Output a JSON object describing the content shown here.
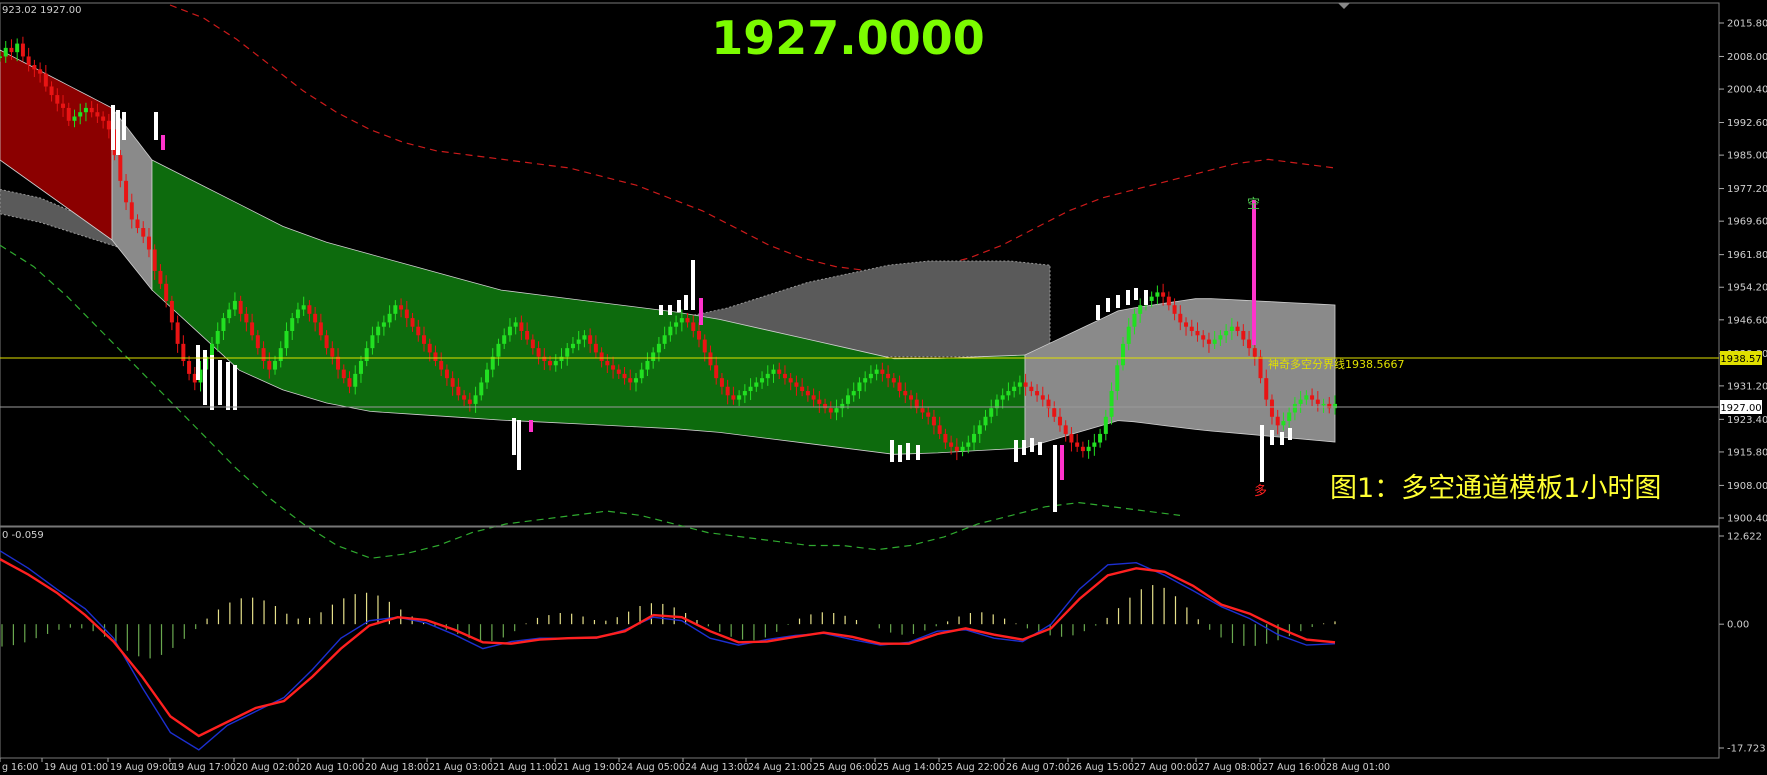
{
  "chart_data": [
    {
      "type": "candlestick",
      "header": "923.02 1927.00",
      "big_price": "1927.0000",
      "big_price_color": "#7cfc00",
      "price_ticks": [
        "2015.80",
        "2008.00",
        "2000.40",
        "1992.60",
        "1985.00",
        "1977.20",
        "1969.60",
        "1961.80",
        "1954.20",
        "1946.60",
        "1938.80",
        "1931.20",
        "1923.40",
        "1915.80",
        "1908.00",
        "1900.40"
      ],
      "price_tick_values": [
        2015.8,
        2008.0,
        2000.4,
        1992.6,
        1985.0,
        1977.2,
        1969.6,
        1961.8,
        1954.2,
        1946.6,
        1938.8,
        1931.2,
        1923.4,
        1915.8,
        1908.0,
        1900.4
      ],
      "ylim": [
        1900.4,
        2015.8
      ],
      "boundary_label": "1938.57",
      "boundary_value": 1938.57,
      "current_label": "1927.00",
      "current_value": 1927.0,
      "boundary_text": "神奇多空分界线1938.5667",
      "signal_sell_text": "空",
      "signal_buy_text": "多",
      "caption": "图1：多空通道模板1小时图",
      "time_labels": [
        "g 16:00",
        "19 Aug 01:00",
        "19 Aug 09:00",
        "19 Aug 17:00",
        "20 Aug 02:00",
        "20 Aug 10:00",
        "20 Aug 18:00",
        "21 Aug 03:00",
        "21 Aug 11:00",
        "21 Aug 19:00",
        "24 Aug 05:00",
        "24 Aug 13:00",
        "24 Aug 21:00",
        "25 Aug 06:00",
        "25 Aug 14:00",
        "25 Aug 22:00",
        "26 Aug 07:00",
        "26 Aug 15:00",
        "27 Aug 00:00",
        "27 Aug 08:00",
        "27 Aug 16:00",
        "28 Aug 01:00"
      ],
      "closes": [
        2008,
        2010,
        2009,
        2011,
        2008,
        2006,
        2005,
        2004,
        2001,
        1999,
        1997,
        1996,
        1993,
        1994,
        1995,
        1996,
        1995,
        1994,
        1993,
        1991,
        1985,
        1979,
        1974,
        1970,
        1968,
        1966,
        1963,
        1958,
        1955,
        1951,
        1946,
        1941,
        1937,
        1934,
        1932,
        1935,
        1938,
        1941,
        1944,
        1947,
        1949,
        1951,
        1948,
        1946,
        1943,
        1940,
        1937,
        1935,
        1937,
        1940,
        1944,
        1947,
        1949,
        1950,
        1948,
        1946,
        1943,
        1940,
        1938,
        1935,
        1933,
        1931,
        1934,
        1937,
        1940,
        1943,
        1945,
        1946,
        1948,
        1950,
        1949,
        1947,
        1945,
        1943,
        1941,
        1939,
        1937,
        1935,
        1933,
        1931,
        1929,
        1928,
        1927,
        1929,
        1932,
        1935,
        1938,
        1941,
        1943,
        1945,
        1946,
        1944,
        1942,
        1940,
        1938,
        1937,
        1936,
        1937,
        1938,
        1940,
        1941,
        1942,
        1943,
        1941,
        1939,
        1937,
        1936,
        1935,
        1934,
        1933,
        1932,
        1933,
        1935,
        1937,
        1939,
        1941,
        1943,
        1945,
        1946,
        1947,
        1946,
        1944,
        1942,
        1939,
        1936,
        1933,
        1931,
        1929,
        1928,
        1929,
        1930,
        1931,
        1932,
        1933,
        1934,
        1935,
        1934,
        1933,
        1932,
        1931,
        1930,
        1929,
        1928,
        1927,
        1926,
        1925,
        1926,
        1927,
        1929,
        1930,
        1932,
        1933,
        1934,
        1935,
        1934,
        1933,
        1932,
        1930,
        1929,
        1928,
        1926,
        1925,
        1924,
        1922,
        1920,
        1918,
        1917,
        1916,
        1917,
        1918,
        1920,
        1922,
        1924,
        1926,
        1928,
        1929,
        1930,
        1931,
        1932,
        1931,
        1930,
        1929,
        1928,
        1926,
        1924,
        1922,
        1920,
        1918,
        1917,
        1916,
        1917,
        1918,
        1920,
        1924,
        1930,
        1936,
        1941,
        1945,
        1948,
        1950,
        1951,
        1952,
        1953,
        1952,
        1950,
        1948,
        1946,
        1945,
        1944,
        1943,
        1942,
        1941,
        1942,
        1943,
        1944,
        1945,
        1944,
        1942,
        1940,
        1938,
        1933,
        1928,
        1924,
        1922,
        1923,
        1925,
        1927,
        1928,
        1929,
        1928,
        1927,
        1927,
        1926,
        1927
      ],
      "upper_red_line": [
        2020,
        2017,
        2012,
        2006,
        2000,
        1995,
        1991,
        1988,
        1986,
        1985,
        1984,
        1983,
        1982,
        1980,
        1978,
        1975,
        1972,
        1968,
        1964,
        1961,
        1959,
        1958,
        1958,
        1959,
        1961,
        1964,
        1968,
        1972,
        1975,
        1977,
        1979,
        1981,
        1983,
        1984,
        1983,
        1982
      ],
      "lower_green_line": [
        1964,
        1959,
        1952,
        1944,
        1936,
        1928,
        1920,
        1912,
        1905,
        1899,
        1894,
        1891,
        1892,
        1894,
        1897,
        1899,
        1900,
        1901,
        1902,
        1901,
        1899,
        1897,
        1896,
        1895,
        1894,
        1894,
        1893,
        1894,
        1896,
        1899,
        1901,
        1903,
        1904,
        1903,
        1902,
        1901
      ],
      "channel_upper": [
        1962,
        1960,
        1957,
        1954,
        1951,
        1948,
        1946,
        1944,
        1942,
        1940,
        1939,
        1938,
        1937,
        1936,
        1936,
        1936,
        1937,
        1938,
        1940,
        1943,
        1946,
        1948,
        1950,
        1951,
        1951,
        1951,
        1950
      ],
      "channel_lower": [
        1977,
        1975,
        1971,
        1965,
        1958,
        1951,
        1945,
        1940,
        1937,
        1935,
        1934,
        1933,
        1932,
        1932,
        1932,
        1933,
        1933,
        1934,
        1935,
        1936,
        1937,
        1938,
        1938,
        1938,
        1938,
        1938,
        1938
      ],
      "macd_ylim": [
        -17.723,
        12.622
      ],
      "macd_ticks": [
        "12.622",
        "0.00",
        "-17.723"
      ],
      "macd_tick_values": [
        12.622,
        0.0,
        -17.723
      ],
      "macd_header": "0 -0.059",
      "macd_hist": [
        -3.2,
        -3.0,
        -2.6,
        -2.0,
        -1.4,
        -0.8,
        -0.5,
        -0.6,
        -1.0,
        -1.8,
        -2.8,
        -3.8,
        -4.6,
        -4.9,
        -4.4,
        -3.4,
        -2.1,
        -0.7,
        0.8,
        2.1,
        3.1,
        3.7,
        3.8,
        3.4,
        2.6,
        1.5,
        0.8,
        0.9,
        1.7,
        2.8,
        3.7,
        4.3,
        4.5,
        4.1,
        3.2,
        2.1,
        1.1,
        0.3,
        -0.3,
        -0.8,
        -1.4,
        -2.0,
        -2.4,
        -2.4,
        -1.9,
        -1.0,
        0.1,
        0.9,
        1.3,
        1.6,
        1.5,
        1.1,
        0.6,
        0.5,
        1.0,
        1.8,
        2.6,
        3.0,
        2.9,
        2.4,
        1.6,
        0.6,
        -0.3,
        -1.1,
        -1.8,
        -2.2,
        -2.3,
        -1.9,
        -1.1,
        -0.1,
        0.8,
        1.4,
        1.7,
        1.6,
        1.2,
        0.6,
        0.0,
        -0.6,
        -1.2,
        -1.5,
        -1.4,
        -0.9,
        -0.3,
        0.4,
        1.1,
        1.6,
        1.7,
        1.4,
        0.8,
        0.1,
        -0.6,
        -1.2,
        -1.6,
        -1.8,
        -1.6,
        -1.0,
        -0.2,
        0.9,
        2.3,
        3.8,
        5.0,
        5.6,
        5.2,
        4.0,
        2.4,
        0.7,
        -0.8,
        -1.9,
        -2.7,
        -3.1,
        -3.1,
        -2.8,
        -2.3,
        -1.7,
        -1.0,
        -0.4,
        0.1,
        0.4
      ],
      "macd_red_line": [
        9.3,
        7.1,
        4.5,
        1.3,
        -2.5,
        -7.5,
        -13.2,
        -16.0,
        -14.0,
        -12.0,
        -11.0,
        -7.5,
        -3.5,
        -0.2,
        1.0,
        0.6,
        -0.8,
        -2.6,
        -2.8,
        -2.2,
        -2.0,
        -1.9,
        -1.0,
        1.3,
        1.0,
        -1.0,
        -2.6,
        -2.5,
        -1.8,
        -1.2,
        -1.8,
        -2.8,
        -2.8,
        -1.4,
        -0.6,
        -1.5,
        -2.2,
        -0.6,
        3.6,
        7.0,
        8.0,
        7.5,
        5.5,
        2.8,
        1.5,
        -0.5,
        -2.2,
        -2.6
      ],
      "macd_blue_line": [
        10.5,
        8.0,
        5.0,
        2.2,
        -2.0,
        -9.0,
        -15.5,
        -18.0,
        -14.5,
        -12.5,
        -10.5,
        -6.5,
        -2.0,
        0.5,
        1.0,
        0.2,
        -1.5,
        -3.5,
        -2.5,
        -2.0,
        -2.0,
        -2.0,
        -0.8,
        1.0,
        0.5,
        -2.0,
        -3.0,
        -2.2,
        -1.6,
        -1.3,
        -2.2,
        -3.0,
        -2.6,
        -1.0,
        -0.8,
        -2.0,
        -2.5,
        0.0,
        5.0,
        8.5,
        8.8,
        7.0,
        4.8,
        2.5,
        0.8,
        -1.5,
        -3.0,
        -2.8
      ]
    }
  ]
}
